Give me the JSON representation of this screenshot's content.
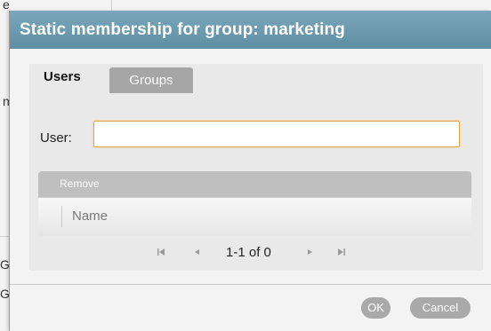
{
  "background": {
    "fragments": [
      "e",
      "n",
      "Gr",
      "Gr"
    ]
  },
  "dialog": {
    "title": "Static membership for group: marketing",
    "tabs": [
      {
        "label": "Users",
        "active": true
      },
      {
        "label": "Groups",
        "active": false
      }
    ],
    "user_field": {
      "label": "User:",
      "value": ""
    },
    "table": {
      "toolbar_button": "Remove",
      "columns": [
        "Name"
      ]
    },
    "pager": {
      "first_icon": "first-page-icon",
      "prev_icon": "prev-page-icon",
      "status": "1-1 of 0",
      "next_icon": "next-page-icon",
      "last_icon": "last-page-icon"
    },
    "buttons": {
      "ok": "OK",
      "cancel": "Cancel"
    }
  },
  "colors": {
    "titlebar": "#6b9aae",
    "input_focus_border": "#e0a64a",
    "button_bg": "#a9a9a9"
  }
}
